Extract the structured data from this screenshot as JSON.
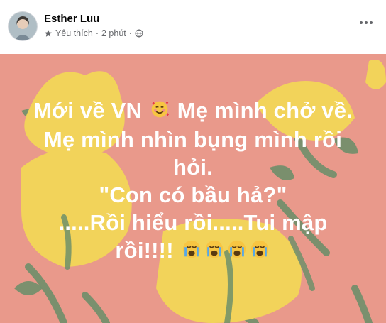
{
  "post": {
    "author": "Esther Luu",
    "audience_label": "Yêu thích",
    "separator": "·",
    "time": "2 phút",
    "lines": [
      "Mới về VN",
      "Mẹ mình chở về.",
      "Mẹ mình nhìn bụng mình rồi",
      "hỏi.",
      "\"Con có bầu hả?\"",
      ".....Rồi hiểu rồi.....Tui mập",
      "rồi!!!!"
    ],
    "background_color": "#e9998b",
    "text_color": "#ffffff",
    "icons": {
      "audience": "star-icon",
      "privacy": "globe-icon",
      "more": "more-options-icon",
      "emoji_inline": "smiling-face-with-hearts-icon",
      "emoji_cry": "loudly-crying-face-icon"
    }
  }
}
